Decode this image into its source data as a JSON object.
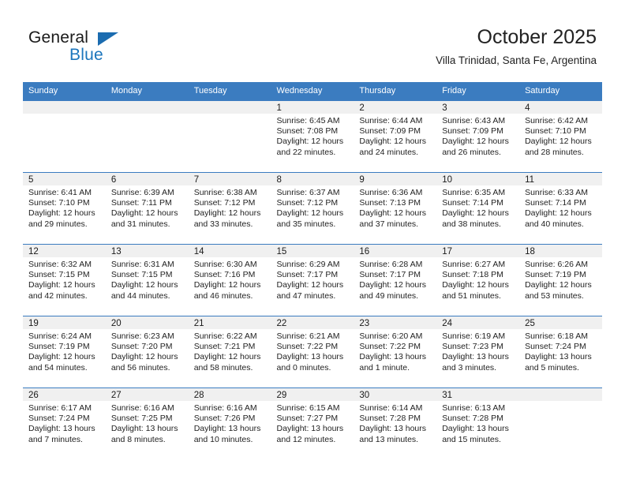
{
  "brand": {
    "name_part1": "General",
    "name_part2": "Blue",
    "logo_icon": "triangle-flag-icon",
    "accent_color": "#1b75bc"
  },
  "header": {
    "title": "October 2025",
    "subtitle": "Villa Trinidad, Santa Fe, Argentina"
  },
  "calendar": {
    "header_color": "#3b7cc0",
    "day_band_color": "#f0f0f0",
    "weekdays": [
      "Sunday",
      "Monday",
      "Tuesday",
      "Wednesday",
      "Thursday",
      "Friday",
      "Saturday"
    ],
    "weeks": [
      [
        {
          "day": "",
          "sunrise": "",
          "sunset": "",
          "daylight_l1": "",
          "daylight_l2": ""
        },
        {
          "day": "",
          "sunrise": "",
          "sunset": "",
          "daylight_l1": "",
          "daylight_l2": ""
        },
        {
          "day": "",
          "sunrise": "",
          "sunset": "",
          "daylight_l1": "",
          "daylight_l2": ""
        },
        {
          "day": "1",
          "sunrise": "Sunrise: 6:45 AM",
          "sunset": "Sunset: 7:08 PM",
          "daylight_l1": "Daylight: 12 hours",
          "daylight_l2": "and 22 minutes."
        },
        {
          "day": "2",
          "sunrise": "Sunrise: 6:44 AM",
          "sunset": "Sunset: 7:09 PM",
          "daylight_l1": "Daylight: 12 hours",
          "daylight_l2": "and 24 minutes."
        },
        {
          "day": "3",
          "sunrise": "Sunrise: 6:43 AM",
          "sunset": "Sunset: 7:09 PM",
          "daylight_l1": "Daylight: 12 hours",
          "daylight_l2": "and 26 minutes."
        },
        {
          "day": "4",
          "sunrise": "Sunrise: 6:42 AM",
          "sunset": "Sunset: 7:10 PM",
          "daylight_l1": "Daylight: 12 hours",
          "daylight_l2": "and 28 minutes."
        }
      ],
      [
        {
          "day": "5",
          "sunrise": "Sunrise: 6:41 AM",
          "sunset": "Sunset: 7:10 PM",
          "daylight_l1": "Daylight: 12 hours",
          "daylight_l2": "and 29 minutes."
        },
        {
          "day": "6",
          "sunrise": "Sunrise: 6:39 AM",
          "sunset": "Sunset: 7:11 PM",
          "daylight_l1": "Daylight: 12 hours",
          "daylight_l2": "and 31 minutes."
        },
        {
          "day": "7",
          "sunrise": "Sunrise: 6:38 AM",
          "sunset": "Sunset: 7:12 PM",
          "daylight_l1": "Daylight: 12 hours",
          "daylight_l2": "and 33 minutes."
        },
        {
          "day": "8",
          "sunrise": "Sunrise: 6:37 AM",
          "sunset": "Sunset: 7:12 PM",
          "daylight_l1": "Daylight: 12 hours",
          "daylight_l2": "and 35 minutes."
        },
        {
          "day": "9",
          "sunrise": "Sunrise: 6:36 AM",
          "sunset": "Sunset: 7:13 PM",
          "daylight_l1": "Daylight: 12 hours",
          "daylight_l2": "and 37 minutes."
        },
        {
          "day": "10",
          "sunrise": "Sunrise: 6:35 AM",
          "sunset": "Sunset: 7:14 PM",
          "daylight_l1": "Daylight: 12 hours",
          "daylight_l2": "and 38 minutes."
        },
        {
          "day": "11",
          "sunrise": "Sunrise: 6:33 AM",
          "sunset": "Sunset: 7:14 PM",
          "daylight_l1": "Daylight: 12 hours",
          "daylight_l2": "and 40 minutes."
        }
      ],
      [
        {
          "day": "12",
          "sunrise": "Sunrise: 6:32 AM",
          "sunset": "Sunset: 7:15 PM",
          "daylight_l1": "Daylight: 12 hours",
          "daylight_l2": "and 42 minutes."
        },
        {
          "day": "13",
          "sunrise": "Sunrise: 6:31 AM",
          "sunset": "Sunset: 7:15 PM",
          "daylight_l1": "Daylight: 12 hours",
          "daylight_l2": "and 44 minutes."
        },
        {
          "day": "14",
          "sunrise": "Sunrise: 6:30 AM",
          "sunset": "Sunset: 7:16 PM",
          "daylight_l1": "Daylight: 12 hours",
          "daylight_l2": "and 46 minutes."
        },
        {
          "day": "15",
          "sunrise": "Sunrise: 6:29 AM",
          "sunset": "Sunset: 7:17 PM",
          "daylight_l1": "Daylight: 12 hours",
          "daylight_l2": "and 47 minutes."
        },
        {
          "day": "16",
          "sunrise": "Sunrise: 6:28 AM",
          "sunset": "Sunset: 7:17 PM",
          "daylight_l1": "Daylight: 12 hours",
          "daylight_l2": "and 49 minutes."
        },
        {
          "day": "17",
          "sunrise": "Sunrise: 6:27 AM",
          "sunset": "Sunset: 7:18 PM",
          "daylight_l1": "Daylight: 12 hours",
          "daylight_l2": "and 51 minutes."
        },
        {
          "day": "18",
          "sunrise": "Sunrise: 6:26 AM",
          "sunset": "Sunset: 7:19 PM",
          "daylight_l1": "Daylight: 12 hours",
          "daylight_l2": "and 53 minutes."
        }
      ],
      [
        {
          "day": "19",
          "sunrise": "Sunrise: 6:24 AM",
          "sunset": "Sunset: 7:19 PM",
          "daylight_l1": "Daylight: 12 hours",
          "daylight_l2": "and 54 minutes."
        },
        {
          "day": "20",
          "sunrise": "Sunrise: 6:23 AM",
          "sunset": "Sunset: 7:20 PM",
          "daylight_l1": "Daylight: 12 hours",
          "daylight_l2": "and 56 minutes."
        },
        {
          "day": "21",
          "sunrise": "Sunrise: 6:22 AM",
          "sunset": "Sunset: 7:21 PM",
          "daylight_l1": "Daylight: 12 hours",
          "daylight_l2": "and 58 minutes."
        },
        {
          "day": "22",
          "sunrise": "Sunrise: 6:21 AM",
          "sunset": "Sunset: 7:22 PM",
          "daylight_l1": "Daylight: 13 hours",
          "daylight_l2": "and 0 minutes."
        },
        {
          "day": "23",
          "sunrise": "Sunrise: 6:20 AM",
          "sunset": "Sunset: 7:22 PM",
          "daylight_l1": "Daylight: 13 hours",
          "daylight_l2": "and 1 minute."
        },
        {
          "day": "24",
          "sunrise": "Sunrise: 6:19 AM",
          "sunset": "Sunset: 7:23 PM",
          "daylight_l1": "Daylight: 13 hours",
          "daylight_l2": "and 3 minutes."
        },
        {
          "day": "25",
          "sunrise": "Sunrise: 6:18 AM",
          "sunset": "Sunset: 7:24 PM",
          "daylight_l1": "Daylight: 13 hours",
          "daylight_l2": "and 5 minutes."
        }
      ],
      [
        {
          "day": "26",
          "sunrise": "Sunrise: 6:17 AM",
          "sunset": "Sunset: 7:24 PM",
          "daylight_l1": "Daylight: 13 hours",
          "daylight_l2": "and 7 minutes."
        },
        {
          "day": "27",
          "sunrise": "Sunrise: 6:16 AM",
          "sunset": "Sunset: 7:25 PM",
          "daylight_l1": "Daylight: 13 hours",
          "daylight_l2": "and 8 minutes."
        },
        {
          "day": "28",
          "sunrise": "Sunrise: 6:16 AM",
          "sunset": "Sunset: 7:26 PM",
          "daylight_l1": "Daylight: 13 hours",
          "daylight_l2": "and 10 minutes."
        },
        {
          "day": "29",
          "sunrise": "Sunrise: 6:15 AM",
          "sunset": "Sunset: 7:27 PM",
          "daylight_l1": "Daylight: 13 hours",
          "daylight_l2": "and 12 minutes."
        },
        {
          "day": "30",
          "sunrise": "Sunrise: 6:14 AM",
          "sunset": "Sunset: 7:28 PM",
          "daylight_l1": "Daylight: 13 hours",
          "daylight_l2": "and 13 minutes."
        },
        {
          "day": "31",
          "sunrise": "Sunrise: 6:13 AM",
          "sunset": "Sunset: 7:28 PM",
          "daylight_l1": "Daylight: 13 hours",
          "daylight_l2": "and 15 minutes."
        },
        {
          "day": "",
          "sunrise": "",
          "sunset": "",
          "daylight_l1": "",
          "daylight_l2": ""
        }
      ]
    ]
  }
}
